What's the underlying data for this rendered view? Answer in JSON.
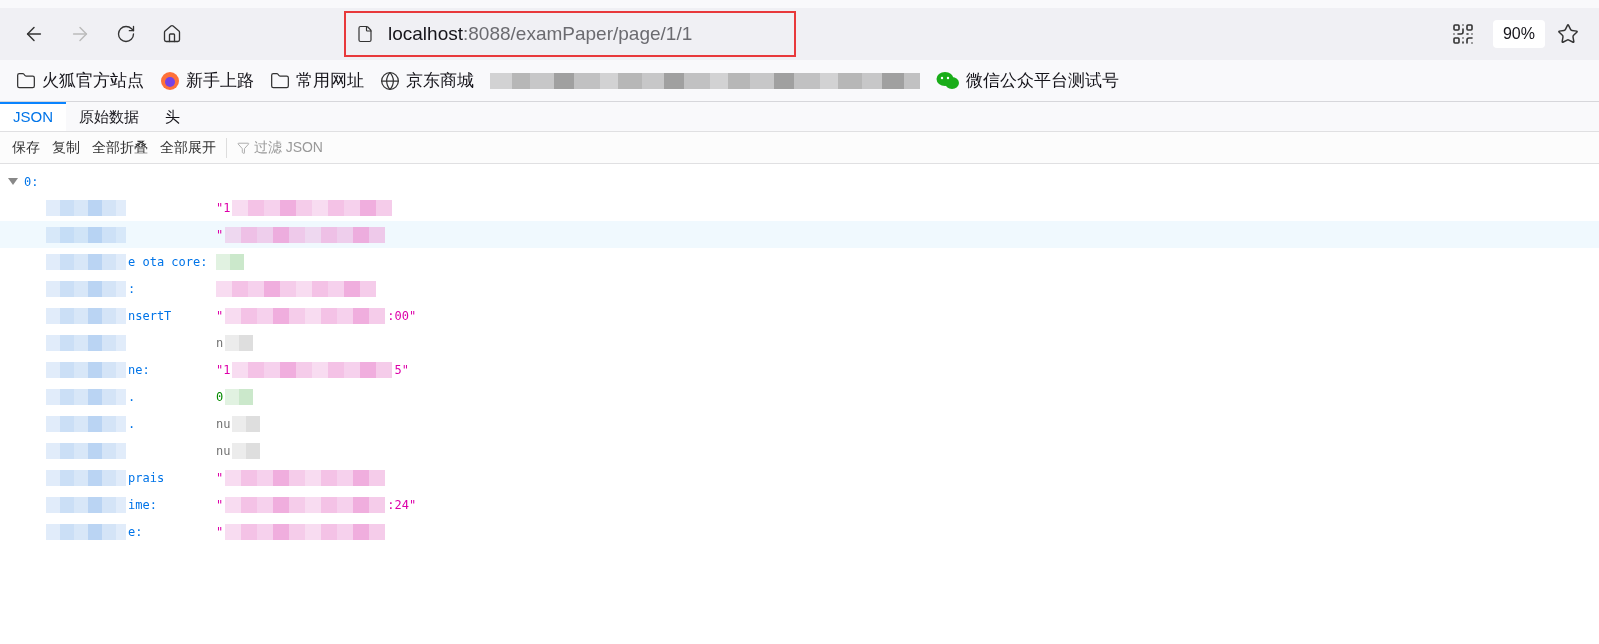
{
  "nav": {
    "back_disabled": false,
    "forward_disabled": true
  },
  "url": {
    "host": "localhost",
    "rest": ":8088/examPaper/page/1/1"
  },
  "zoom": "90%",
  "bookmarks": [
    {
      "kind": "folder",
      "label": "火狐官方站点"
    },
    {
      "kind": "firefox",
      "label": "新手上路"
    },
    {
      "kind": "folder",
      "label": "常用网址"
    },
    {
      "kind": "globe",
      "label": "京东商城"
    },
    {
      "kind": "hidden"
    },
    {
      "kind": "wechat",
      "label": "微信公众平台测试号"
    }
  ],
  "viewer_tabs": [
    {
      "label": "JSON",
      "selected": true
    },
    {
      "label": "原始数据",
      "selected": false
    },
    {
      "label": "头",
      "selected": false
    }
  ],
  "viewer_buttons": [
    "保存",
    "复制",
    "全部折叠",
    "全部展开"
  ],
  "filter": {
    "placeholder": "过滤 JSON"
  },
  "root": {
    "key": "0:",
    "expanded": true
  },
  "rows": [
    {
      "kind": "string",
      "value_start": "\"1",
      "selected": false
    },
    {
      "kind": "string",
      "value_start": "\"",
      "selected": true
    },
    {
      "kind": "number",
      "key": "e ota core:",
      "selected": false
    },
    {
      "kind": "string",
      "key": ":",
      "selected": false
    },
    {
      "kind": "string",
      "key": "nsertT",
      "value_start": "\"",
      "value_end": ":00\"",
      "selected": false
    },
    {
      "kind": "null",
      "value_start": "n",
      "selected": false
    },
    {
      "kind": "string",
      "key": "ne:",
      "value_start": "\"1",
      "value_end": "5\"",
      "selected": false
    },
    {
      "kind": "number",
      "key": ".",
      "value_start": "0",
      "selected": false
    },
    {
      "kind": "null",
      "key": ".",
      "value_start": "nu",
      "selected": false
    },
    {
      "kind": "null",
      "value_start": "nu",
      "selected": false
    },
    {
      "kind": "string",
      "key": "prais",
      "value_start": "\"",
      "selected": false
    },
    {
      "kind": "string",
      "key": "ime:",
      "value_start": "\"",
      "value_end": ":24\"",
      "selected": false
    },
    {
      "kind": "string",
      "key": "e:",
      "value_start": "\"",
      "selected": false
    }
  ]
}
